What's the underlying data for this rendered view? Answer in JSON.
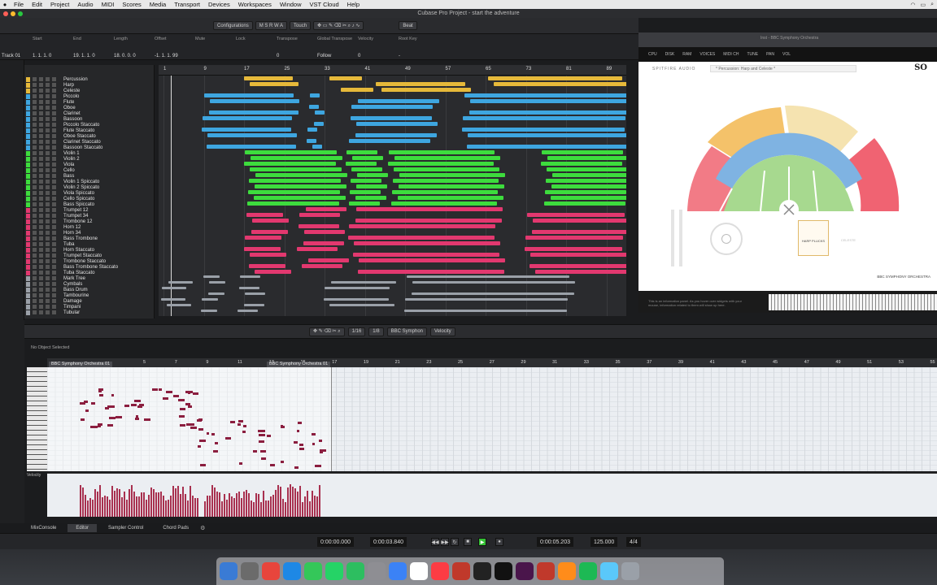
{
  "menubar": {
    "app_name": "File",
    "items": [
      "Edit",
      "Project",
      "Audio",
      "MIDI",
      "Scores",
      "Media",
      "Transport",
      "Devices",
      "Workspaces",
      "Window",
      "VST Cloud",
      "Help"
    ]
  },
  "window": {
    "title": "Cubase Pro Project - start the adventure"
  },
  "toolbar": {
    "configurations": "Configurations",
    "mode_keys": "M S R W A",
    "touch": "Touch",
    "snap": "Beat"
  },
  "infoline": {
    "labels": [
      "Start",
      "End",
      "Length",
      "Offset",
      "Mute",
      "Lock",
      "Transpose",
      "Global Transpose",
      "Velocity",
      "Root Key"
    ],
    "values": [
      "1. 1. 1. 0",
      "19. 1. 1. 0",
      "18. 0. 0. 0",
      "-1. 1. 1. 99",
      "",
      "",
      "0",
      "Follow",
      "0",
      "-"
    ],
    "left_values": [
      "Track 01",
      "1. 1. 1. 0"
    ]
  },
  "ruler_top": [
    "1",
    "9",
    "17",
    "25",
    "33",
    "41",
    "49",
    "57",
    "65",
    "73",
    "81",
    "89"
  ],
  "tracks": [
    {
      "name": "Percussion",
      "color": "#e6b93a"
    },
    {
      "name": "Harp",
      "color": "#e6b93a"
    },
    {
      "name": "Celeste",
      "color": "#e6b93a"
    },
    {
      "name": "Piccolo",
      "color": "#3ea6e0"
    },
    {
      "name": "Flute",
      "color": "#3ea6e0"
    },
    {
      "name": "Oboe",
      "color": "#3ea6e0"
    },
    {
      "name": "Clarinet",
      "color": "#3ea6e0"
    },
    {
      "name": "Bassoon",
      "color": "#3ea6e0"
    },
    {
      "name": "Piccolo Staccato",
      "color": "#3ea6e0"
    },
    {
      "name": "Flute Staccato",
      "color": "#3ea6e0"
    },
    {
      "name": "Oboe Staccato",
      "color": "#3ea6e0"
    },
    {
      "name": "Clarinet Staccato",
      "color": "#3ea6e0"
    },
    {
      "name": "Bassoon Staccato",
      "color": "#3ea6e0"
    },
    {
      "name": "Violin 1",
      "color": "#3ddc3d"
    },
    {
      "name": "Violin 2",
      "color": "#3ddc3d"
    },
    {
      "name": "Viola",
      "color": "#3ddc3d"
    },
    {
      "name": "Cello",
      "color": "#3ddc3d"
    },
    {
      "name": "Bass",
      "color": "#3ddc3d"
    },
    {
      "name": "Violin 1 Spiccato",
      "color": "#3ddc3d"
    },
    {
      "name": "Violin 2 Spiccato",
      "color": "#3ddc3d"
    },
    {
      "name": "Viola Spiccato",
      "color": "#3ddc3d"
    },
    {
      "name": "Cello Spiccato",
      "color": "#3ddc3d"
    },
    {
      "name": "Bass Spiccato",
      "color": "#3ddc3d"
    },
    {
      "name": "Trumpet 12",
      "color": "#e2386f"
    },
    {
      "name": "Trumpet 34",
      "color": "#e2386f"
    },
    {
      "name": "Trombone 12",
      "color": "#e2386f"
    },
    {
      "name": "Horn 12",
      "color": "#e2386f"
    },
    {
      "name": "Horn 34",
      "color": "#e2386f"
    },
    {
      "name": "Bass Trombone",
      "color": "#e2386f"
    },
    {
      "name": "Tuba",
      "color": "#e2386f"
    },
    {
      "name": "Horn Staccato",
      "color": "#e2386f"
    },
    {
      "name": "Trumpet Staccato",
      "color": "#e2386f"
    },
    {
      "name": "Trombone Staccato",
      "color": "#e2386f"
    },
    {
      "name": "Bass Trombone Staccato",
      "color": "#e2386f"
    },
    {
      "name": "Tuba Staccato",
      "color": "#e2386f"
    },
    {
      "name": "Mark Tree",
      "color": "#9aa0a8"
    },
    {
      "name": "Cymbals",
      "color": "#9aa0a8"
    },
    {
      "name": "Bass Drum",
      "color": "#9aa0a8"
    },
    {
      "name": "Tambourine",
      "color": "#9aa0a8"
    },
    {
      "name": "Damage",
      "color": "#9aa0a8"
    },
    {
      "name": "Timpani",
      "color": "#9aa0a8"
    },
    {
      "name": "Tubular",
      "color": "#9aa0a8"
    }
  ],
  "plugin": {
    "title": "Inst - BBC Symphony Orchestra",
    "header_items": [
      "CPU",
      "DISK",
      "RAM",
      "VOICES",
      "MIDI CH",
      "TUNE",
      "PAN",
      "VOL"
    ],
    "brand": "SPITFIRE AUDIO",
    "preset": "* Percussion: Harp and Celeste *",
    "logo": "SO",
    "bbc_text": "BBC SYMPHONY ORCHESTRA",
    "info_text": "This is an information panel. As you hover over widgets with your mouse, information related to them will show up here.",
    "articulation_1": "HARP PLUCKS",
    "articulation_2": "CELESTE"
  },
  "lower_zone": {
    "no_object": "No Object Selected",
    "part_label_1": "BBC Symphony Orchestra 01",
    "part_label_2": "BBC Symphony Orchestra 01",
    "quantize": "1/16",
    "length": "1/8",
    "instrument": "BBC Symphon",
    "lane": "Velocity",
    "velocity_label": "Velocity",
    "ruler": [
      "5",
      "7",
      "9",
      "11",
      "13",
      "15",
      "17",
      "19",
      "21",
      "23",
      "25",
      "27",
      "29",
      "31",
      "33",
      "35",
      "37",
      "39",
      "41",
      "43",
      "45",
      "47",
      "49",
      "51",
      "53",
      "55"
    ]
  },
  "tabs": [
    "MixConsole",
    "Editor",
    "Sampler Control",
    "Chord Pads"
  ],
  "transport": {
    "left_locator": "0:00:00.000",
    "right_locator": "0:00:03.840",
    "position": "0:00:05.203",
    "tempo": "125.000",
    "signature": "4/4"
  },
  "dock": [
    "Finder",
    "Launchpad",
    "Chrome",
    "Safari",
    "Messages",
    "WhatsApp",
    "Evernote",
    "Preview",
    "Mail",
    "Calendar",
    "Music",
    "Cubase",
    "Live",
    "Sonos",
    "Slack",
    "Cubase",
    "Ableton",
    "Spotify",
    "Downloads",
    "Trash"
  ]
}
